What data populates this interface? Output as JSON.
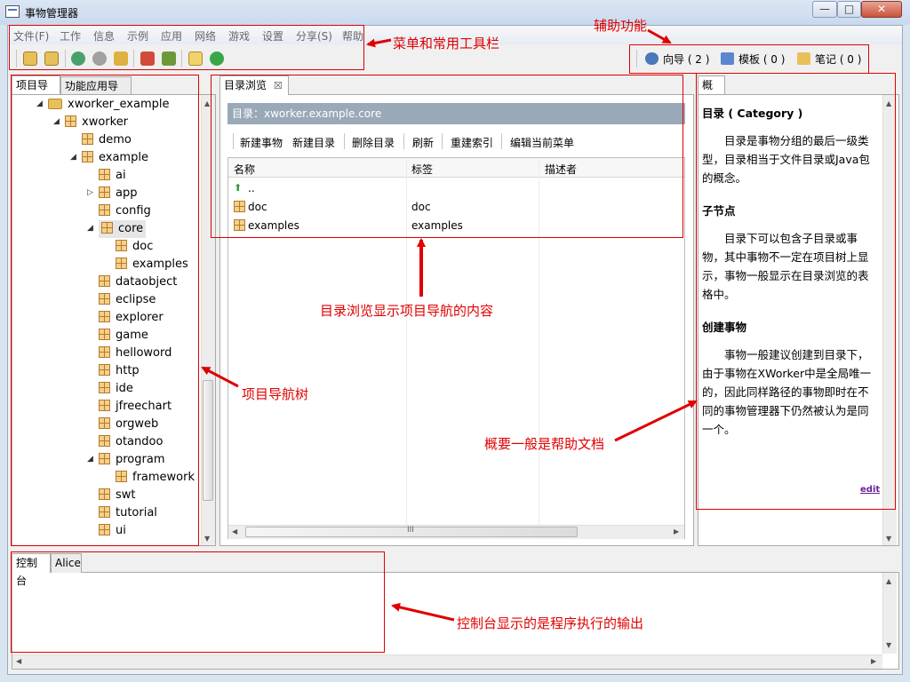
{
  "window": {
    "title": "事物管理器",
    "minimize": "—",
    "maximize": "□",
    "close": "✕"
  },
  "menu": [
    "文件(F)",
    "工作",
    "信息",
    "示例",
    "应用",
    "网络",
    "游戏",
    "设置",
    "分享(S)",
    "帮助"
  ],
  "assist": {
    "guide": "向导 ( 2 )",
    "template": "模板 ( 0 )",
    "notes": "笔记 ( 0 )"
  },
  "left_tabs": [
    "项目导航",
    "功能应用导航"
  ],
  "tree": [
    {
      "label": "xworker_example",
      "level": 0,
      "type": "project",
      "expander": "◢"
    },
    {
      "label": "xworker",
      "level": 1,
      "type": "node",
      "expander": "◢"
    },
    {
      "label": "demo",
      "level": 2,
      "type": "node",
      "expander": ""
    },
    {
      "label": "example",
      "level": 2,
      "type": "node",
      "expander": "◢"
    },
    {
      "label": "ai",
      "level": 3,
      "type": "node",
      "expander": ""
    },
    {
      "label": "app",
      "level": 3,
      "type": "node",
      "expander": "▷"
    },
    {
      "label": "config",
      "level": 3,
      "type": "node",
      "expander": ""
    },
    {
      "label": "core",
      "level": 3,
      "type": "node",
      "expander": "◢",
      "selected": true
    },
    {
      "label": "doc",
      "level": 4,
      "type": "node",
      "expander": ""
    },
    {
      "label": "examples",
      "level": 4,
      "type": "node",
      "expander": ""
    },
    {
      "label": "dataobject",
      "level": 3,
      "type": "node",
      "expander": ""
    },
    {
      "label": "eclipse",
      "level": 3,
      "type": "node",
      "expander": ""
    },
    {
      "label": "explorer",
      "level": 3,
      "type": "node",
      "expander": ""
    },
    {
      "label": "game",
      "level": 3,
      "type": "node",
      "expander": ""
    },
    {
      "label": "helloword",
      "level": 3,
      "type": "node",
      "expander": ""
    },
    {
      "label": "http",
      "level": 3,
      "type": "node",
      "expander": ""
    },
    {
      "label": "ide",
      "level": 3,
      "type": "node",
      "expander": ""
    },
    {
      "label": "jfreechart",
      "level": 3,
      "type": "node",
      "expander": ""
    },
    {
      "label": "orgweb",
      "level": 3,
      "type": "node",
      "expander": ""
    },
    {
      "label": "otandoo",
      "level": 3,
      "type": "node",
      "expander": ""
    },
    {
      "label": "program",
      "level": 3,
      "type": "node",
      "expander": "◢"
    },
    {
      "label": "framework",
      "level": 4,
      "type": "node",
      "expander": ""
    },
    {
      "label": "swt",
      "level": 3,
      "type": "node",
      "expander": ""
    },
    {
      "label": "tutorial",
      "level": 3,
      "type": "node",
      "expander": ""
    },
    {
      "label": "ui",
      "level": 3,
      "type": "node",
      "expander": ""
    }
  ],
  "dir_browser": {
    "tab_label": "目录浏览",
    "tab_close": "☒",
    "path": "目录：xworker.example.core",
    "actions": [
      "新建事物",
      "新建目录",
      "删除目录",
      "刷新",
      "重建索引",
      "编辑当前菜单"
    ],
    "columns": [
      "名称",
      "标签",
      "描述者"
    ],
    "rows": [
      {
        "name": "..",
        "label": "",
        "desc": "",
        "type": "up"
      },
      {
        "name": "doc",
        "label": "doc",
        "desc": "",
        "type": "node"
      },
      {
        "name": "examples",
        "label": "examples",
        "desc": "",
        "type": "node"
      }
    ],
    "hscroll_grip": "III"
  },
  "summary": {
    "tab_label": "概要",
    "h1": "目录 ( Category )",
    "p1": "目录是事物分组的最后一级类型，目录相当于文件目录或Java包的概念。",
    "h2": "子节点",
    "p2": "目录下可以包含子目录或事物，其中事物不一定在项目树上显示，事物一般显示在目录浏览的表格中。",
    "h3": "创建事物",
    "p3": "事物一般建议创建到目录下，由于事物在XWorker中是全局唯一的，因此同样路径的事物即时在不同的事物管理器下仍然被认为是同一个。",
    "edit_link": "edit"
  },
  "console": {
    "tabs": [
      "控制台",
      "Alice"
    ]
  },
  "annotations": {
    "menu_toolbar": "菜单和常用工具栏",
    "assist": "辅助功能",
    "tree": "项目导航树",
    "dir_browser": "目录浏览显示项目导航的内容",
    "summary": "概要一般是帮助文档",
    "console": "控制台显示的是程序执行的输出"
  },
  "colors": {
    "annotation": "#e00000",
    "path_bar": "#9aa9b8",
    "selection": "#e6e6e6"
  }
}
